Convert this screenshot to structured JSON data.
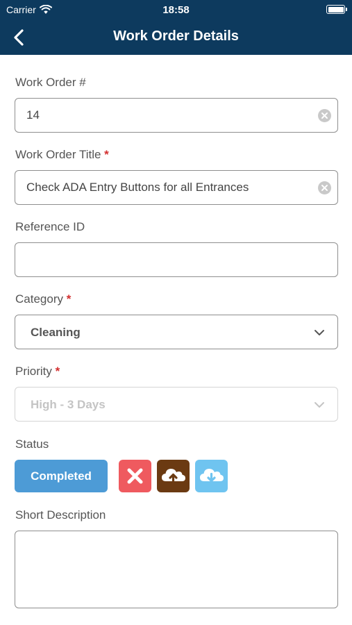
{
  "status_bar": {
    "carrier": "Carrier",
    "time": "18:58"
  },
  "nav": {
    "title": "Work Order Details"
  },
  "fields": {
    "work_order_number": {
      "label": "Work Order #",
      "value": "14"
    },
    "work_order_title": {
      "label": "Work Order Title",
      "required_mark": "*",
      "value": "Check ADA Entry Buttons for all Entrances"
    },
    "reference_id": {
      "label": "Reference ID",
      "value": ""
    },
    "category": {
      "label": "Category",
      "required_mark": "*",
      "value": "Cleaning"
    },
    "priority": {
      "label": "Priority",
      "required_mark": "*",
      "value": "High - 3 Days"
    },
    "status": {
      "label": "Status",
      "value": "Completed"
    },
    "short_description": {
      "label": "Short Description",
      "value": ""
    }
  },
  "status_actions": [
    {
      "icon": "close-icon",
      "color": "#ef5a5f"
    },
    {
      "icon": "cloud-upload-icon",
      "color": "#6b3a12"
    },
    {
      "icon": "cloud-download-icon",
      "color": "#6fc4f0"
    }
  ],
  "colors": {
    "header": "#0d3a5e",
    "status_button": "#4d9bd6",
    "required": "#d32f2f"
  }
}
